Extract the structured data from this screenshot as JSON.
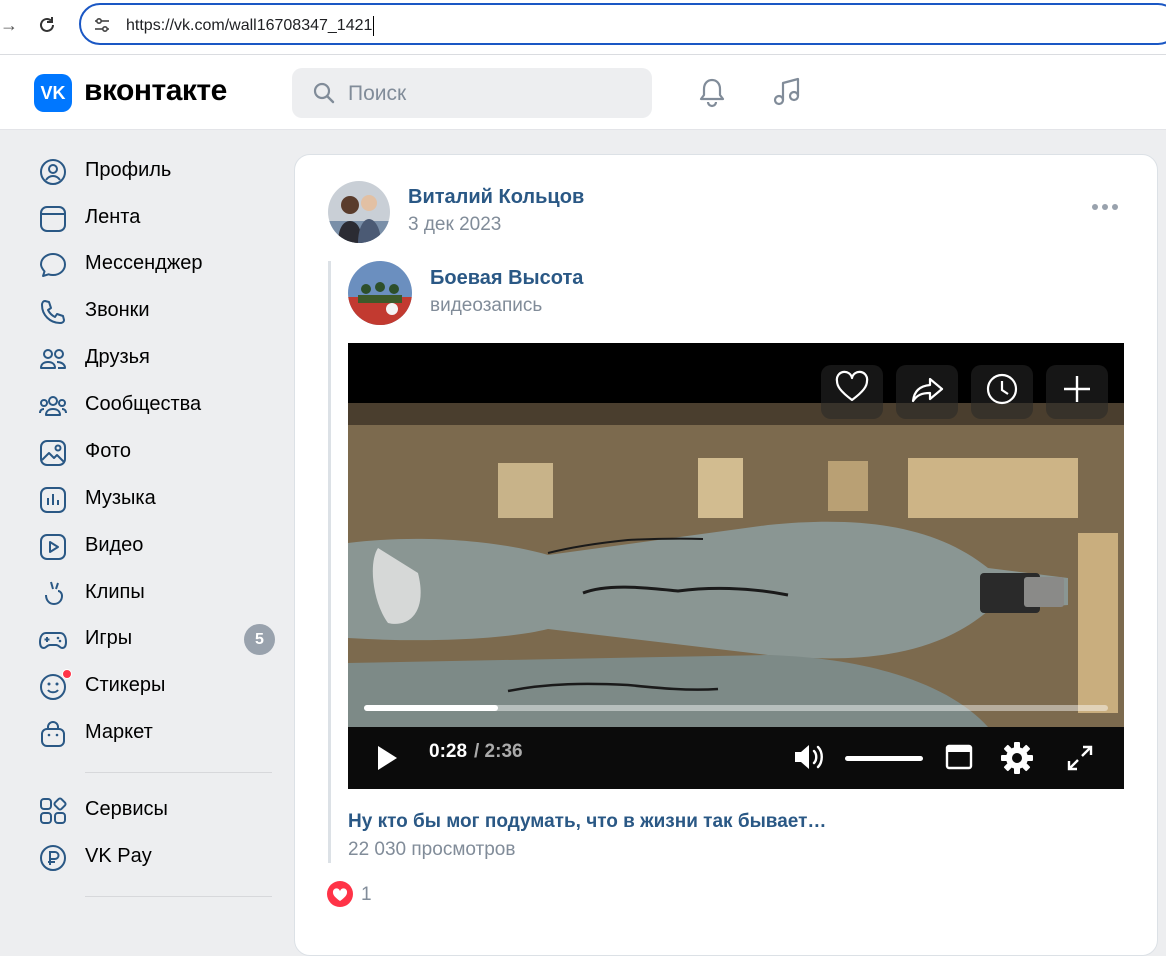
{
  "browser": {
    "url": "https://vk.com/wall16708347_1421"
  },
  "header": {
    "logo_text": "VK",
    "wordmark": "вконтакте",
    "search_placeholder": "Поиск"
  },
  "sidebar": {
    "items": [
      {
        "label": "Профиль",
        "icon": "profile-icon"
      },
      {
        "label": "Лента",
        "icon": "feed-icon"
      },
      {
        "label": "Мессенджер",
        "icon": "messenger-icon"
      },
      {
        "label": "Звонки",
        "icon": "phone-icon"
      },
      {
        "label": "Друзья",
        "icon": "friends-icon"
      },
      {
        "label": "Сообщества",
        "icon": "communities-icon"
      },
      {
        "label": "Фото",
        "icon": "photo-icon"
      },
      {
        "label": "Музыка",
        "icon": "music-bars-icon"
      },
      {
        "label": "Видео",
        "icon": "video-icon"
      },
      {
        "label": "Клипы",
        "icon": "clips-icon"
      },
      {
        "label": "Игры",
        "icon": "gamepad-icon",
        "badge": "5"
      },
      {
        "label": "Стикеры",
        "icon": "sticker-icon"
      },
      {
        "label": "Маркет",
        "icon": "market-bag-icon"
      }
    ],
    "items2": [
      {
        "label": "Сервисы",
        "icon": "services-icon"
      },
      {
        "label": "VK Pay",
        "icon": "vkpay-icon"
      }
    ]
  },
  "post": {
    "author": "Виталий Кольцов",
    "date": "3 дек 2023",
    "repost": {
      "source": "Боевая Высота",
      "type": "видеозапись"
    },
    "video": {
      "current_time": "0:28",
      "total_time": "/ 2:36",
      "progress": 0.18,
      "buffered": 0.75,
      "volume": 1.0
    },
    "caption": "Ну кто бы мог подумать, что в жизни так бывает…",
    "views": "22 030 просмотров",
    "likes": "1"
  },
  "colors": {
    "accent": "#0077ff",
    "link": "#2a5885",
    "muted": "#818c99",
    "badge": "#99a2ad",
    "like": "#ff3347"
  }
}
